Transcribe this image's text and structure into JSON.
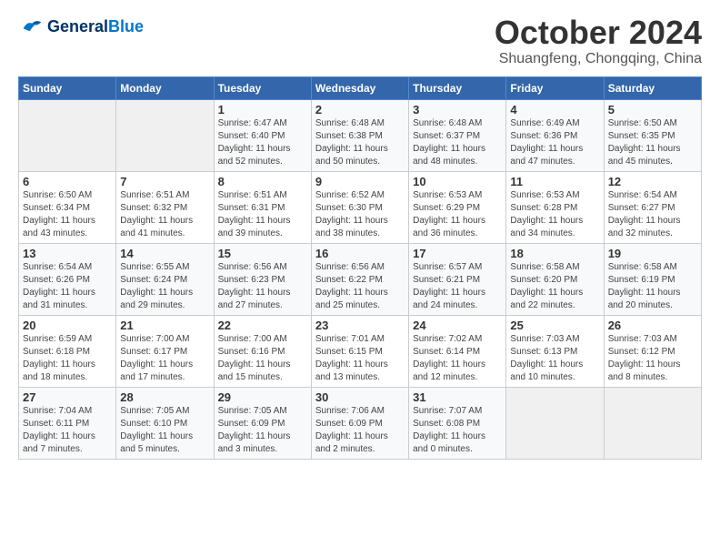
{
  "logo": {
    "text_general": "General",
    "text_blue": "Blue"
  },
  "calendar": {
    "title": "October 2024",
    "subtitle": "Shuangfeng, Chongqing, China"
  },
  "days_of_week": [
    "Sunday",
    "Monday",
    "Tuesday",
    "Wednesday",
    "Thursday",
    "Friday",
    "Saturday"
  ],
  "weeks": [
    [
      {
        "day": "",
        "info": ""
      },
      {
        "day": "",
        "info": ""
      },
      {
        "day": "1",
        "info": "Sunrise: 6:47 AM\nSunset: 6:40 PM\nDaylight: 11 hours and 52 minutes."
      },
      {
        "day": "2",
        "info": "Sunrise: 6:48 AM\nSunset: 6:38 PM\nDaylight: 11 hours and 50 minutes."
      },
      {
        "day": "3",
        "info": "Sunrise: 6:48 AM\nSunset: 6:37 PM\nDaylight: 11 hours and 48 minutes."
      },
      {
        "day": "4",
        "info": "Sunrise: 6:49 AM\nSunset: 6:36 PM\nDaylight: 11 hours and 47 minutes."
      },
      {
        "day": "5",
        "info": "Sunrise: 6:50 AM\nSunset: 6:35 PM\nDaylight: 11 hours and 45 minutes."
      }
    ],
    [
      {
        "day": "6",
        "info": "Sunrise: 6:50 AM\nSunset: 6:34 PM\nDaylight: 11 hours and 43 minutes."
      },
      {
        "day": "7",
        "info": "Sunrise: 6:51 AM\nSunset: 6:32 PM\nDaylight: 11 hours and 41 minutes."
      },
      {
        "day": "8",
        "info": "Sunrise: 6:51 AM\nSunset: 6:31 PM\nDaylight: 11 hours and 39 minutes."
      },
      {
        "day": "9",
        "info": "Sunrise: 6:52 AM\nSunset: 6:30 PM\nDaylight: 11 hours and 38 minutes."
      },
      {
        "day": "10",
        "info": "Sunrise: 6:53 AM\nSunset: 6:29 PM\nDaylight: 11 hours and 36 minutes."
      },
      {
        "day": "11",
        "info": "Sunrise: 6:53 AM\nSunset: 6:28 PM\nDaylight: 11 hours and 34 minutes."
      },
      {
        "day": "12",
        "info": "Sunrise: 6:54 AM\nSunset: 6:27 PM\nDaylight: 11 hours and 32 minutes."
      }
    ],
    [
      {
        "day": "13",
        "info": "Sunrise: 6:54 AM\nSunset: 6:26 PM\nDaylight: 11 hours and 31 minutes."
      },
      {
        "day": "14",
        "info": "Sunrise: 6:55 AM\nSunset: 6:24 PM\nDaylight: 11 hours and 29 minutes."
      },
      {
        "day": "15",
        "info": "Sunrise: 6:56 AM\nSunset: 6:23 PM\nDaylight: 11 hours and 27 minutes."
      },
      {
        "day": "16",
        "info": "Sunrise: 6:56 AM\nSunset: 6:22 PM\nDaylight: 11 hours and 25 minutes."
      },
      {
        "day": "17",
        "info": "Sunrise: 6:57 AM\nSunset: 6:21 PM\nDaylight: 11 hours and 24 minutes."
      },
      {
        "day": "18",
        "info": "Sunrise: 6:58 AM\nSunset: 6:20 PM\nDaylight: 11 hours and 22 minutes."
      },
      {
        "day": "19",
        "info": "Sunrise: 6:58 AM\nSunset: 6:19 PM\nDaylight: 11 hours and 20 minutes."
      }
    ],
    [
      {
        "day": "20",
        "info": "Sunrise: 6:59 AM\nSunset: 6:18 PM\nDaylight: 11 hours and 18 minutes."
      },
      {
        "day": "21",
        "info": "Sunrise: 7:00 AM\nSunset: 6:17 PM\nDaylight: 11 hours and 17 minutes."
      },
      {
        "day": "22",
        "info": "Sunrise: 7:00 AM\nSunset: 6:16 PM\nDaylight: 11 hours and 15 minutes."
      },
      {
        "day": "23",
        "info": "Sunrise: 7:01 AM\nSunset: 6:15 PM\nDaylight: 11 hours and 13 minutes."
      },
      {
        "day": "24",
        "info": "Sunrise: 7:02 AM\nSunset: 6:14 PM\nDaylight: 11 hours and 12 minutes."
      },
      {
        "day": "25",
        "info": "Sunrise: 7:03 AM\nSunset: 6:13 PM\nDaylight: 11 hours and 10 minutes."
      },
      {
        "day": "26",
        "info": "Sunrise: 7:03 AM\nSunset: 6:12 PM\nDaylight: 11 hours and 8 minutes."
      }
    ],
    [
      {
        "day": "27",
        "info": "Sunrise: 7:04 AM\nSunset: 6:11 PM\nDaylight: 11 hours and 7 minutes."
      },
      {
        "day": "28",
        "info": "Sunrise: 7:05 AM\nSunset: 6:10 PM\nDaylight: 11 hours and 5 minutes."
      },
      {
        "day": "29",
        "info": "Sunrise: 7:05 AM\nSunset: 6:09 PM\nDaylight: 11 hours and 3 minutes."
      },
      {
        "day": "30",
        "info": "Sunrise: 7:06 AM\nSunset: 6:09 PM\nDaylight: 11 hours and 2 minutes."
      },
      {
        "day": "31",
        "info": "Sunrise: 7:07 AM\nSunset: 6:08 PM\nDaylight: 11 hours and 0 minutes."
      },
      {
        "day": "",
        "info": ""
      },
      {
        "day": "",
        "info": ""
      }
    ]
  ]
}
